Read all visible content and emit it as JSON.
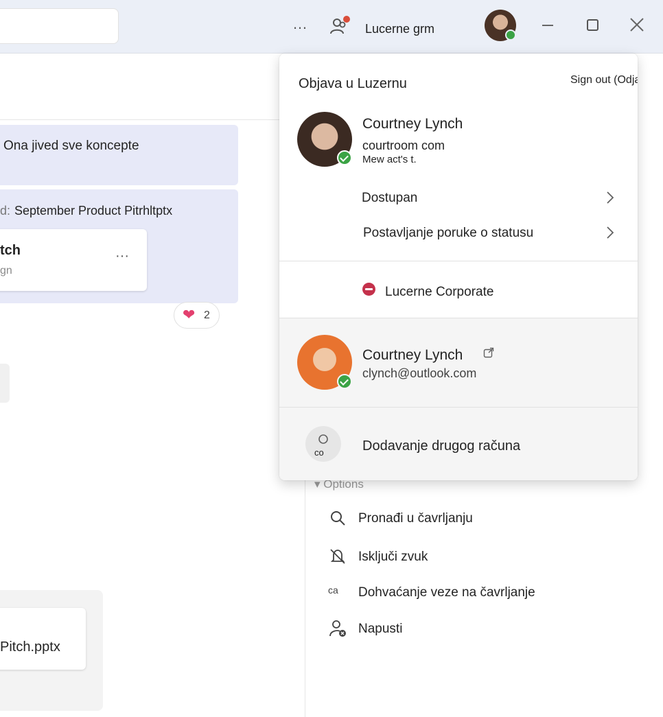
{
  "titlebar": {
    "more_icon": "…",
    "org_name": "Lucerne grm"
  },
  "chat": {
    "message1": "Ona jived sve koncepte",
    "message2_prefix": "d:",
    "message2": "September Product Pitrhltptx",
    "file_card_title": "tch",
    "file_card_subtitle": "gn",
    "file_card_more": "···",
    "reaction_count": "2",
    "pptx_name": "Pitch.pptx"
  },
  "options": {
    "label": "▾ Options",
    "items": [
      {
        "label": "Pronađi u čavrljanju",
        "icon": "search-icon"
      },
      {
        "label": "Isključi zvuk",
        "icon": "mute-bell-icon"
      },
      {
        "label": "Dohvaćanje veze na čavrljanje",
        "icon_text": "ca",
        "icon": "link-icon"
      },
      {
        "label": "Napusti",
        "icon": "leave-icon"
      }
    ]
  },
  "account_popup": {
    "org_title": "Objava u Luzernu",
    "sign_out": "Sign out (Odjava)",
    "primary": {
      "name": "Courtney Lynch",
      "email": "courtroom com",
      "status_message": "Mew act's t."
    },
    "availability": "Dostupan",
    "status_message_action": "Postavljanje poruke o statusu",
    "org_account": "Lucerne Corporate",
    "secondary": {
      "name": "Courtney Lynch",
      "email": "clynch@outlook.com"
    },
    "add_account_avatar_text": "co",
    "add_account": "Dodavanje drugog računa"
  },
  "colors": {
    "accent": "#e7e9f8",
    "available": "#3ba345",
    "busy": "#c4314b",
    "titlebar": "#ebeff7"
  }
}
